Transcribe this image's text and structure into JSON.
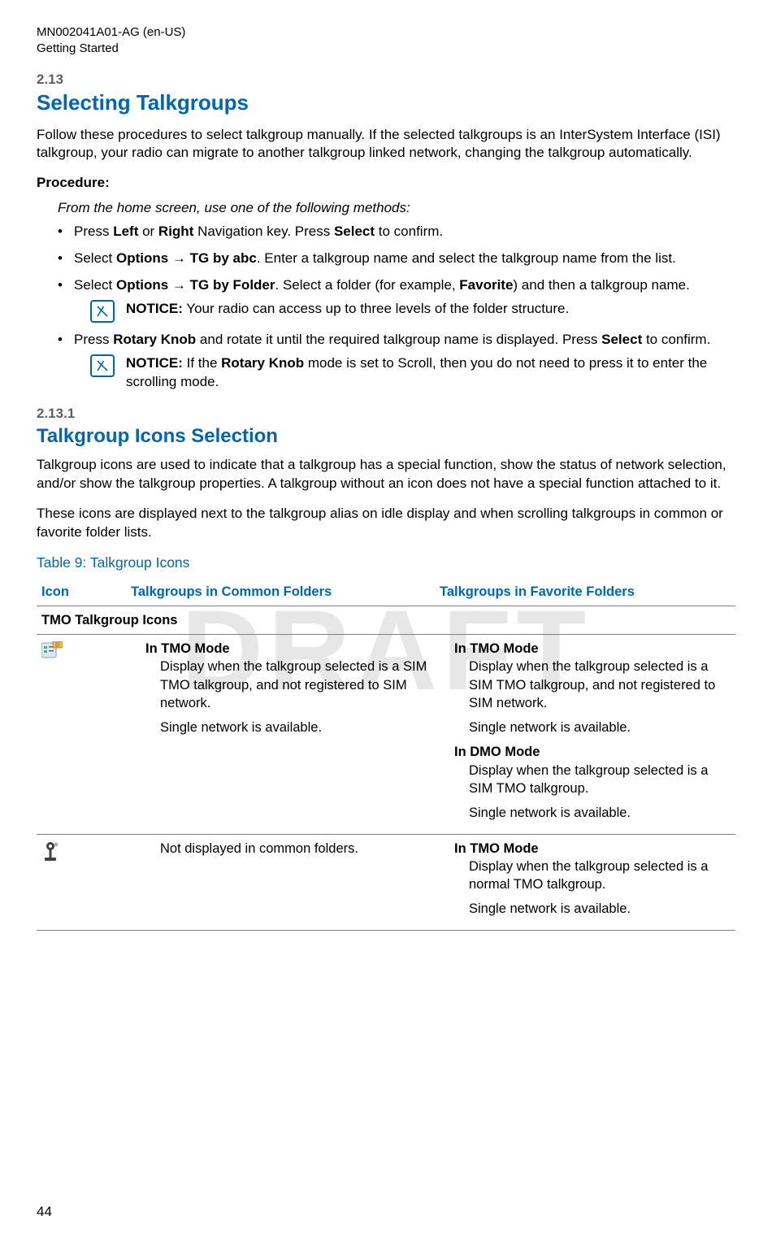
{
  "header": {
    "doc_id": "MN002041A01-AG (en-US)",
    "section": "Getting Started"
  },
  "watermark": "DRAFT",
  "section_2_13": {
    "num": "2.13",
    "title": "Selecting Talkgroups",
    "intro": "Follow these procedures to select talkgroup manually. If the selected talkgroups is an InterSystem Interface (ISI) talkgroup, your radio can migrate to another talkgroup linked network, changing the talkgroup automatically.",
    "procedure_label": "Procedure:",
    "instruction_intro": "From the home screen, use one of the following methods:",
    "bullets": [
      {
        "pre": "Press ",
        "b1": "Left",
        "mid1": " or ",
        "b2": "Right",
        "mid2": " Navigation key. Press ",
        "b3": "Select",
        "post": " to confirm."
      },
      {
        "pre": "Select ",
        "b1": "Options",
        "arrow": " → ",
        "b2": "TG by abc",
        "post": ". Enter a talkgroup name and select the talkgroup name from the list."
      },
      {
        "pre": "Select ",
        "b1": "Options",
        "arrow": " → ",
        "b2": "TG by Folder",
        "mid": ". Select a folder (for example, ",
        "b3": "Favorite",
        "post": ") and then a talkgroup name."
      },
      {
        "pre": "Press ",
        "b1": "Rotary Knob",
        "mid": " and rotate it until the required talkgroup name is displayed. Press ",
        "b2": "Select",
        "post": " to confirm."
      }
    ],
    "notice1": {
      "label": "NOTICE:",
      "text": " Your radio can access up to three levels of the folder structure."
    },
    "notice2": {
      "label": "NOTICE:",
      "pre": " If the ",
      "b1": "Rotary Knob",
      "post": " mode is set to Scroll, then you do not need to press it to enter the scrolling mode."
    }
  },
  "section_2_13_1": {
    "num": "2.13.1",
    "title": "Talkgroup Icons Selection",
    "para1": "Talkgroup icons are used to indicate that a talkgroup has a special function, show the status of network selection, and/or show the talkgroup properties. A talkgroup without an icon does not have a special function attached to it.",
    "para2": "These icons are displayed next to the talkgroup alias on idle display and when scrolling talkgroups in common or favorite folder lists."
  },
  "table": {
    "caption": "Table 9: Talkgroup Icons",
    "headers": {
      "col1": "Icon",
      "col2": "Talkgroups in Common Folders",
      "col3": "Talkgroups in Favorite Folders"
    },
    "subheader": "TMO Talkgroup Icons",
    "row1": {
      "col2": {
        "mode1": "In TMO Mode",
        "desc1": "Display when the talkgroup selected is a SIM TMO talkgroup, and not registered to SIM network.",
        "extra1": "Single network is available."
      },
      "col3": {
        "mode1": "In TMO Mode",
        "desc1": "Display when the talkgroup selected is a SIM TMO talkgroup, and not registered to SIM network.",
        "extra1": "Single network is available.",
        "mode2": "In DMO Mode",
        "desc2": "Display when the talkgroup selected is a SIM TMO talkgroup.",
        "extra2": "Single network is available."
      }
    },
    "row2": {
      "col2": {
        "text": "Not displayed in common folders."
      },
      "col3": {
        "mode1": "In TMO Mode",
        "desc1": "Display when the talkgroup selected is a normal TMO talkgroup.",
        "extra1": "Single network is available."
      }
    }
  },
  "page_number": "44"
}
